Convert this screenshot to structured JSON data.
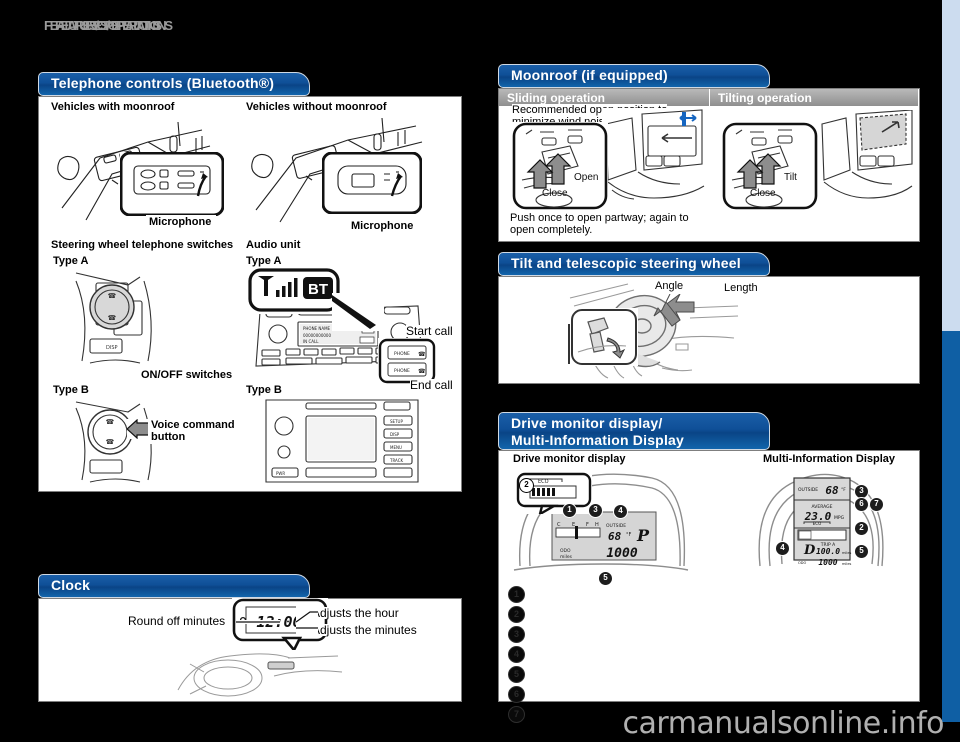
{
  "page": {
    "header_title": "FEATURES/OPERATIONS",
    "watermark": "carmanualsonline.info"
  },
  "sections": {
    "telephone": {
      "title": "Telephone controls (Bluetooth®)",
      "labels": {
        "vehicles_with_moonroof": "Vehicles with moonroof",
        "vehicles_without_moonroof": "Vehicles without moonroof",
        "microphone_left": "Microphone",
        "microphone_right": "Microphone",
        "steering_switches": "Steering wheel telephone switches",
        "audio_unit": "Audio unit",
        "type_a_left": "Type A",
        "type_b_left": "Type B",
        "type_a_right": "Type A",
        "type_b_right": "Type B",
        "on_off_switches": "ON/OFF switches",
        "voice_command_button": "Voice command\nbutton",
        "voice_command_line1": "Voice command",
        "voice_command_line2": "button",
        "start_call": "Start call",
        "end_call": "End call",
        "bt_badge": "BT",
        "disp_button": "DISP"
      },
      "audio_display": {
        "line1": "PHONE NAME",
        "line2": "00000000000",
        "line3": "IN CALL"
      }
    },
    "clock": {
      "title": "Clock",
      "labels": {
        "round_off_minutes": "Round off minutes",
        "adjusts_hour": "Adjusts the hour",
        "adjusts_minutes": "Adjusts the minutes"
      },
      "display_value": "12:00"
    },
    "moonroof": {
      "title": "Moonroof (if equipped)",
      "sub_left": "Sliding operation",
      "sub_right": "Tilting operation",
      "labels": {
        "recommended_line1": "Recommended open position to",
        "recommended_line2": "minimize wind noise.",
        "open": "Open",
        "close": "Close",
        "push_line1": "Push once to open partway; again to",
        "push_line2": "open completely.",
        "tilt": "Tilt",
        "tilt_close": "Close"
      }
    },
    "steering": {
      "title": "Tilt and telescopic steering wheel",
      "labels": {
        "angle": "Angle",
        "length": "Length"
      }
    },
    "drive_monitor": {
      "title_line1": "Drive monitor display/",
      "title_line2": "Multi-Information Display",
      "sub_left": "Drive monitor display",
      "sub_right": "Multi-Information Display",
      "dm_display": {
        "outside_label": "OUTSIDE",
        "outside_value": "68",
        "outside_unit": "°F",
        "gear": "P",
        "odo_label": "ODO",
        "odo_unit": "miles",
        "odo_value": "1000",
        "temp_cold": "C",
        "temp_hot": "H",
        "fuel_e": "E",
        "fuel_f": "F",
        "eco_label": "ECO"
      },
      "mid_display": {
        "outside_label": "OUTSIDE",
        "outside_value": "68",
        "outside_unit": "°F",
        "average_label": "AVERAGE",
        "average_value": "23.0",
        "average_unit": "MPG",
        "eco_label": "ECO",
        "gear": "D",
        "trip_label": "TRIP A",
        "trip_value": "100.0",
        "trip_unit": "miles",
        "odo_label": "ODO",
        "odo_value": "1000",
        "odo_unit": "miles"
      },
      "callouts": [
        "1",
        "2",
        "3",
        "4",
        "5",
        "6",
        "7"
      ],
      "legend_numbers": [
        "1",
        "2",
        "3",
        "4",
        "5",
        "6",
        "7"
      ]
    }
  },
  "colors": {
    "header_blue": "#0f4f97",
    "subbar_gray": "#9a9a9a",
    "rail_light": "#ccdcef",
    "rail_dark": "#0f5fa4",
    "page_bg": "#000000"
  }
}
